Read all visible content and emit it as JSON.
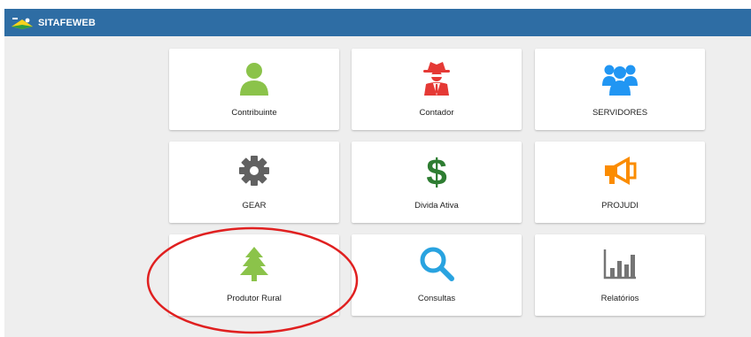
{
  "header": {
    "title": "SITAFEWEB",
    "logo_icon": "state-flag-icon",
    "color": "#2e6da4"
  },
  "tiles": [
    {
      "label": "Contribuinte",
      "icon": "user-icon",
      "color": "#8bc34a"
    },
    {
      "label": "Contador",
      "icon": "spy-icon",
      "color": "#e53935"
    },
    {
      "label": "SERVIDORES",
      "icon": "users-group-icon",
      "color": "#2196f3"
    },
    {
      "label": "GEAR",
      "icon": "gear-icon",
      "color": "#616161"
    },
    {
      "label": "Divida Ativa",
      "icon": "dollar-icon",
      "color": "#2e7d32"
    },
    {
      "label": "PROJUDI",
      "icon": "megaphone-icon",
      "color": "#fb8c00"
    },
    {
      "label": "Produtor Rural",
      "icon": "tree-icon",
      "color": "#8bc34a"
    },
    {
      "label": "Consultas",
      "icon": "search-icon",
      "color": "#29a3e0"
    },
    {
      "label": "Relatórios",
      "icon": "bar-chart-icon",
      "color": "#757575"
    }
  ],
  "annotation": {
    "shape": "ellipse",
    "color": "#e02020",
    "target": "Produtor Rural"
  }
}
